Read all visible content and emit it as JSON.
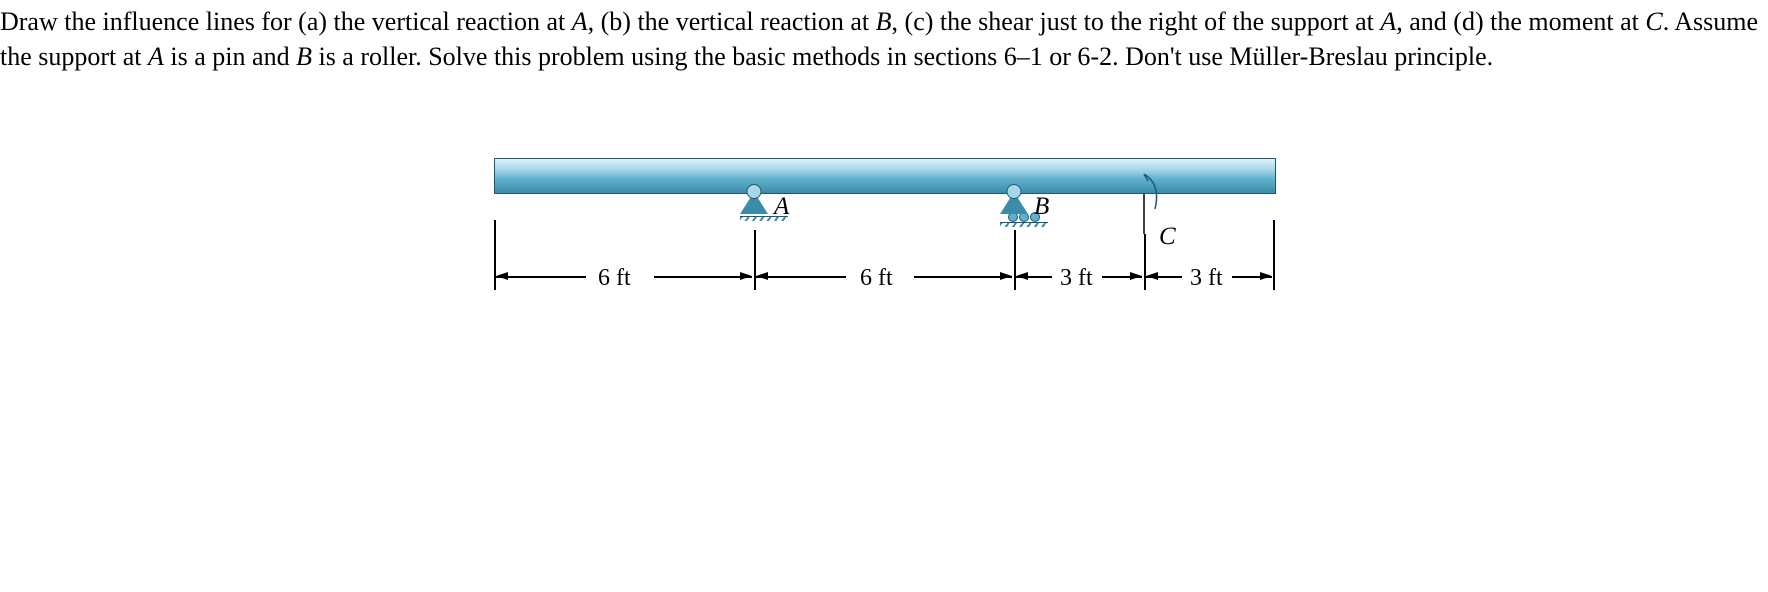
{
  "problem": {
    "text_parts": [
      "Draw the influence lines for (a) the vertical reaction at ",
      "A",
      ", (b) the vertical reaction at ",
      "B",
      ", (c) the shear just to the right of the support at ",
      "A",
      ", and (d) the moment at ",
      "C",
      ". Assume the support at ",
      "A",
      " is a pin and ",
      "B",
      " is a roller. Solve this problem using the basic methods in sections 6–1 or 6-2. Don't use Müller-Breslau principle."
    ]
  },
  "figure": {
    "supports": {
      "A": {
        "label": "A",
        "type": "pin"
      },
      "B": {
        "label": "B",
        "type": "roller"
      }
    },
    "point_C": {
      "label": "C"
    },
    "dimensions": {
      "span1": "6 ft",
      "span2": "6 ft",
      "span3": "3 ft",
      "span4": "3 ft"
    }
  }
}
